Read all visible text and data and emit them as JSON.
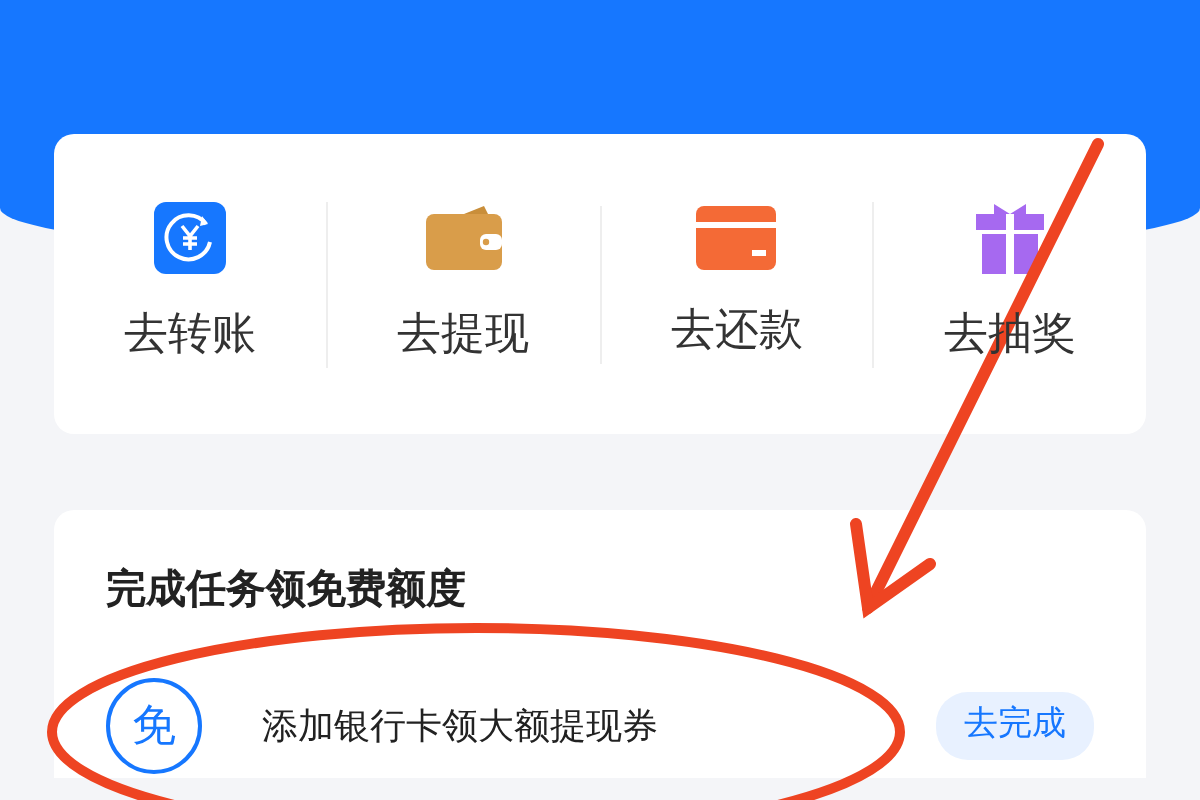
{
  "quick_actions": [
    {
      "kind": "transfer",
      "label": "去转账"
    },
    {
      "kind": "wallet",
      "label": "去提现"
    },
    {
      "kind": "card",
      "label": "去还款"
    },
    {
      "kind": "gift",
      "label": "去抽奖"
    }
  ],
  "tasks_section": {
    "title": "完成任务领免费额度",
    "tasks": [
      {
        "badge": "免",
        "text": "添加银行卡领大额提现券",
        "button": "去完成"
      }
    ]
  }
}
